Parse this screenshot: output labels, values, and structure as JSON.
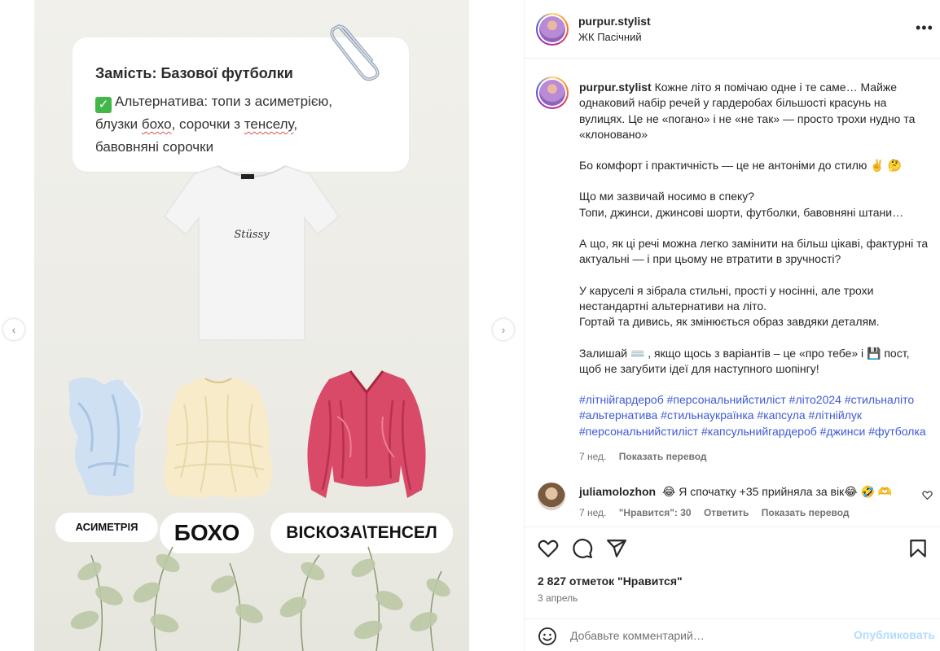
{
  "media": {
    "card_title": "Замість: Базової футболки",
    "card_body_1": "Альтернатива: топи з асиметрією,",
    "card_body_2a": "блузки ",
    "card_body_2b": "бохо",
    "card_body_2c": ", сорочки з ",
    "card_body_2d": "тенселу",
    "card_body_2e": ",",
    "card_body_3": "бавовняні сорочки",
    "check_icon": "✓",
    "tshirt_brand": "Stüssy",
    "label_asym": "АСИМЕТРІЯ",
    "label_boho": "БОХО",
    "label_visc": "ВІСКОЗА\\ТЕНСЕЛ",
    "nav_prev": "‹",
    "nav_next": "›"
  },
  "header": {
    "username": "purpur.stylist",
    "location": "ЖК Пасічний",
    "more": "•••"
  },
  "caption": {
    "username": "purpur.stylist",
    "p1_first": "Кожне літо я помічаю одне і те саме…",
    "p1_rest": "Майже однаковий набір речей у гардеробах більшості красунь на вулицях. Це не «погано» і не «не так» — просто трохи нудно та «клоновано»",
    "p2": "Бо комфорт і практичність — це не антоніми до стилю ✌️ 🤔",
    "p3a": "Що ми зазвичай носимо в спеку?",
    "p3b": "Топи, джинси, джинсові шорти, футболки, бавовняні штани…",
    "p4": "А що, як ці речі можна легко замінити на більш цікаві, фактурні та актуальні — і при цьому не втратити в зручності?",
    "p5a": "У каруселі я зібрала стильні, прості у носінні, але трохи нестандартні альтернативи на літо.",
    "p5b": "Гортай та дивись, як змінюється образ завдяки деталям.",
    "p6": "Залишай ⌨️ , якщо щось з варіантів – це «про тебе» і 💾 пост, щоб не загубити ідеї для наступного шопінгу!",
    "hashtags": "#літнійгардероб #персональнийстиліст #літо2024 #стильналіто #альтернатива #стильнаукраїнка #капсула #літнійлук #персональнийстиліст #капсульнийгардероб #джинси #футболка",
    "time": "7 нед.",
    "translate": "Показать перевод"
  },
  "comment": {
    "username": "juliamolozhon",
    "text": "😂 Я спочатку +35 прийняла за вік😂 🤣 🫶",
    "time": "7 нед.",
    "likes": "\"Нравится\": 30",
    "reply": "Ответить",
    "translate": "Показать перевод"
  },
  "stats": {
    "likes": "2 827 отметок \"Нравится\"",
    "date": "3 апрель"
  },
  "add_comment": {
    "placeholder": "Добавьте комментарий…",
    "publish": "Опубликовать"
  },
  "colors": {
    "link": "#3d5ad6",
    "publish_disabled": "#b3dbff",
    "check_green": "#43b649"
  }
}
